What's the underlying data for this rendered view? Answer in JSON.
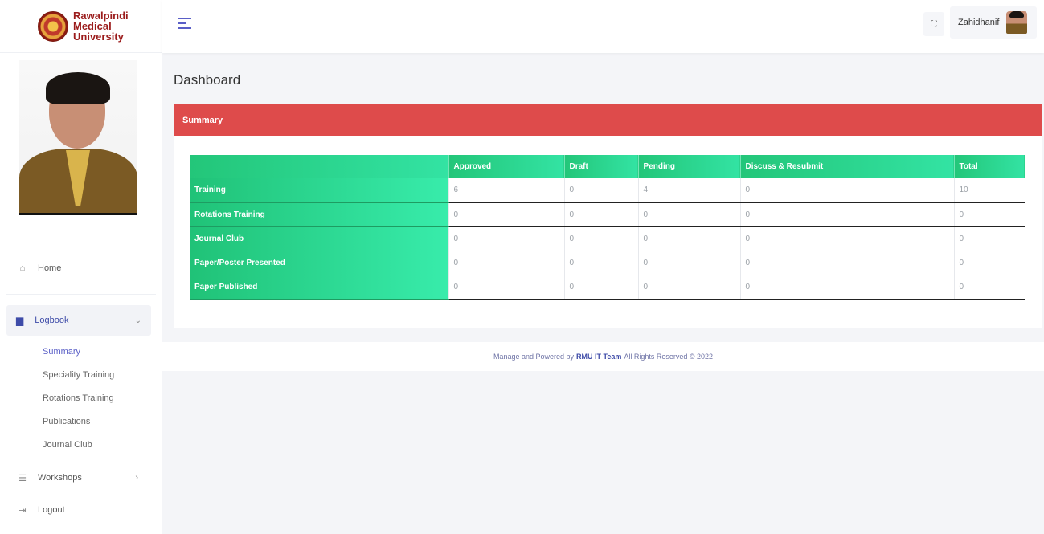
{
  "brand": {
    "name_line1": "Rawalpindi Medical",
    "name_line2": "University"
  },
  "sidebar": {
    "home": "Home",
    "logbook": "Logbook",
    "logbook_items": [
      "Summary",
      "Speciality Training",
      "Rotations Training",
      "Publications",
      "Journal Club"
    ],
    "workshops": "Workshops",
    "logout": "Logout"
  },
  "topbar": {
    "username": "Zahidhanif"
  },
  "page": {
    "title": "Dashboard"
  },
  "summary": {
    "header": "Summary",
    "columns": [
      "",
      "Approved",
      "Draft",
      "Pending",
      "Discuss & Resubmit",
      "Total"
    ],
    "rows": [
      {
        "label": "Training",
        "values": [
          "6",
          "0",
          "4",
          "0",
          "10"
        ]
      },
      {
        "label": "Rotations Training",
        "values": [
          "0",
          "0",
          "0",
          "0",
          "0"
        ]
      },
      {
        "label": "Journal Club",
        "values": [
          "0",
          "0",
          "0",
          "0",
          "0"
        ]
      },
      {
        "label": "Paper/Poster Presented",
        "values": [
          "0",
          "0",
          "0",
          "0",
          "0"
        ]
      },
      {
        "label": "Paper Published",
        "values": [
          "0",
          "0",
          "0",
          "0",
          "0"
        ]
      }
    ]
  },
  "footer": {
    "prefix": "Manage and Powered by",
    "team": "RMU IT Team",
    "suffix": "All Rights Reserved © 2022"
  },
  "colors": {
    "header_red": "#de4b4b",
    "green_start": "#23c679",
    "green_end": "#33e3a3",
    "accent": "#5a5fc7"
  }
}
